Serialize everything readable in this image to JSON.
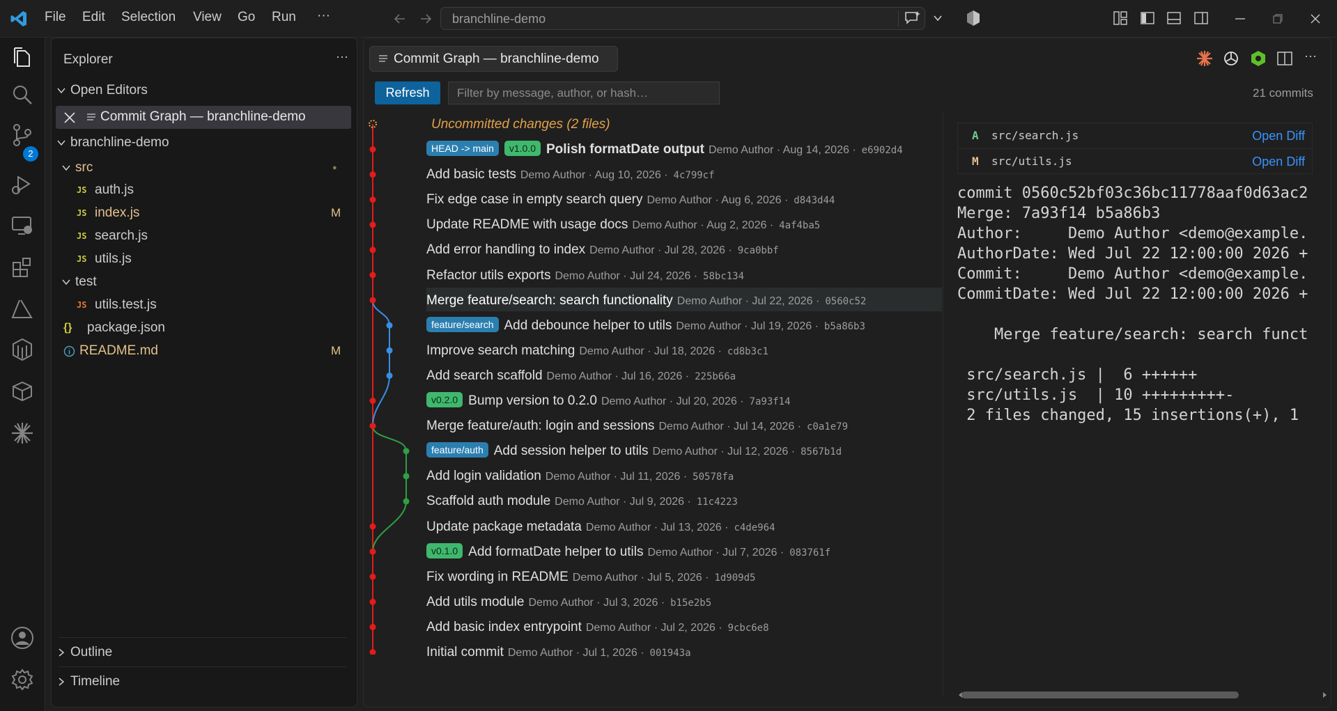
{
  "menu": {
    "items": [
      "File",
      "Edit",
      "Selection",
      "View",
      "Go",
      "Run"
    ],
    "more": "···"
  },
  "command_center": {
    "text": "branchline-demo"
  },
  "activity_bar": {
    "scm_badge": "2"
  },
  "sidebar": {
    "title": "Explorer",
    "more": "···",
    "open_editors": {
      "label": "Open Editors",
      "items": [
        {
          "label": "Commit Graph — branchline-demo"
        }
      ]
    },
    "project": {
      "label": "branchline-demo",
      "tree": [
        {
          "label": "src",
          "type": "folder",
          "status": "●"
        },
        {
          "label": "auth.js",
          "type": "js",
          "status": ""
        },
        {
          "label": "index.js",
          "type": "js",
          "status": "M"
        },
        {
          "label": "search.js",
          "type": "js",
          "status": ""
        },
        {
          "label": "utils.js",
          "type": "js",
          "status": ""
        },
        {
          "label": "test",
          "type": "folder",
          "status": ""
        },
        {
          "label": "utils.test.js",
          "type": "js-test",
          "status": ""
        },
        {
          "label": "package.json",
          "type": "json",
          "status": ""
        },
        {
          "label": "README.md",
          "type": "info",
          "status": "M"
        }
      ]
    },
    "outline": "Outline",
    "timeline": "Timeline"
  },
  "editor": {
    "tab_title": "Commit Graph — branchline-demo",
    "refresh_label": "Refresh",
    "filter_placeholder": "Filter by message, author, or hash…",
    "commit_count": "21 commits",
    "uncommitted": "Uncommitted changes (2 files)",
    "commits": [
      {
        "badges": [
          {
            "text": "HEAD -> main",
            "kind": "blue"
          },
          {
            "text": "v1.0.0",
            "kind": "green"
          }
        ],
        "msg": "Polish formatDate output",
        "meta": "Demo Author · Aug 14, 2026 ·",
        "hash": "e6902d4",
        "lane": 0,
        "bold": true
      },
      {
        "badges": [],
        "msg": "Add basic tests",
        "meta": "Demo Author · Aug 10, 2026 ·",
        "hash": "4c799cf",
        "lane": 0
      },
      {
        "badges": [],
        "msg": "Fix edge case in empty search query",
        "meta": "Demo Author · Aug 6, 2026 ·",
        "hash": "d843d44",
        "lane": 0
      },
      {
        "badges": [],
        "msg": "Update README with usage docs",
        "meta": "Demo Author · Aug 2, 2026 ·",
        "hash": "4af4ba5",
        "lane": 0
      },
      {
        "badges": [],
        "msg": "Add error handling to index",
        "meta": "Demo Author · Jul 28, 2026 ·",
        "hash": "9ca0bbf",
        "lane": 0
      },
      {
        "badges": [],
        "msg": "Refactor utils exports",
        "meta": "Demo Author · Jul 24, 2026 ·",
        "hash": "58bc134",
        "lane": 0
      },
      {
        "badges": [],
        "msg": "Merge feature/search: search functionality",
        "meta": "Demo Author · Jul 22, 2026 ·",
        "hash": "0560c52",
        "lane": 0,
        "selected": true
      },
      {
        "badges": [
          {
            "text": "feature/search",
            "kind": "blue"
          }
        ],
        "msg": "Add debounce helper to utils",
        "meta": "Demo Author · Jul 19, 2026 ·",
        "hash": "b5a86b3",
        "lane": 1
      },
      {
        "badges": [],
        "msg": "Improve search matching",
        "meta": "Demo Author · Jul 18, 2026 ·",
        "hash": "cd8b3c1",
        "lane": 1
      },
      {
        "badges": [],
        "msg": "Add search scaffold",
        "meta": "Demo Author · Jul 16, 2026 ·",
        "hash": "225b66a",
        "lane": 1
      },
      {
        "badges": [
          {
            "text": "v0.2.0",
            "kind": "green"
          }
        ],
        "msg": "Bump version to 0.2.0",
        "meta": "Demo Author · Jul 20, 2026 ·",
        "hash": "7a93f14",
        "lane": 0
      },
      {
        "badges": [],
        "msg": "Merge feature/auth: login and sessions",
        "meta": "Demo Author · Jul 14, 2026 ·",
        "hash": "c0a1e79",
        "lane": 0
      },
      {
        "badges": [
          {
            "text": "feature/auth",
            "kind": "blue"
          }
        ],
        "msg": "Add session helper to utils",
        "meta": "Demo Author · Jul 12, 2026 ·",
        "hash": "8567b1d",
        "lane": 2
      },
      {
        "badges": [],
        "msg": "Add login validation",
        "meta": "Demo Author · Jul 11, 2026 ·",
        "hash": "50578fa",
        "lane": 2
      },
      {
        "badges": [],
        "msg": "Scaffold auth module",
        "meta": "Demo Author · Jul 9, 2026 ·",
        "hash": "11c4223",
        "lane": 2
      },
      {
        "badges": [],
        "msg": "Update package metadata",
        "meta": "Demo Author · Jul 13, 2026 ·",
        "hash": "c4de964",
        "lane": 0
      },
      {
        "badges": [
          {
            "text": "v0.1.0",
            "kind": "green"
          }
        ],
        "msg": "Add formatDate helper to utils",
        "meta": "Demo Author · Jul 7, 2026 ·",
        "hash": "083761f",
        "lane": 0
      },
      {
        "badges": [],
        "msg": "Fix wording in README",
        "meta": "Demo Author · Jul 5, 2026 ·",
        "hash": "1d909d5",
        "lane": 0
      },
      {
        "badges": [],
        "msg": "Add utils module",
        "meta": "Demo Author · Jul 3, 2026 ·",
        "hash": "b15e2b5",
        "lane": 0
      },
      {
        "badges": [],
        "msg": "Add basic index entrypoint",
        "meta": "Demo Author · Jul 2, 2026 ·",
        "hash": "9cbc6e8",
        "lane": 0
      },
      {
        "badges": [],
        "msg": "Initial commit",
        "meta": "Demo Author · Jul 1, 2026 ·",
        "hash": "001943a",
        "lane": 0
      }
    ],
    "detail": {
      "files": [
        {
          "status": "A",
          "path": "src/search.js",
          "action": "Open Diff"
        },
        {
          "status": "M",
          "path": "src/utils.js",
          "action": "Open Diff"
        }
      ],
      "text": "commit 0560c52bf03c36bc11778aaf0d63ac2\nMerge: 7a93f14 b5a86b3\nAuthor:     Demo Author <demo@example.\nAuthorDate: Wed Jul 22 12:00:00 2026 +\nCommit:     Demo Author <demo@example.\nCommitDate: Wed Jul 22 12:00:00 2026 +\n\n    Merge feature/search: search funct\n\n src/search.js |  6 ++++++\n src/utils.js  | 10 +++++++++-\n 2 files changed, 15 insertions(+), 1"
    }
  },
  "colors": {
    "lane_main": "#e51b1b",
    "lane_search": "#3a8ee6",
    "lane_auth": "#2ea043",
    "accent": "#0e639c",
    "link": "#3794ff",
    "uncommitted": "#e2a24a"
  }
}
